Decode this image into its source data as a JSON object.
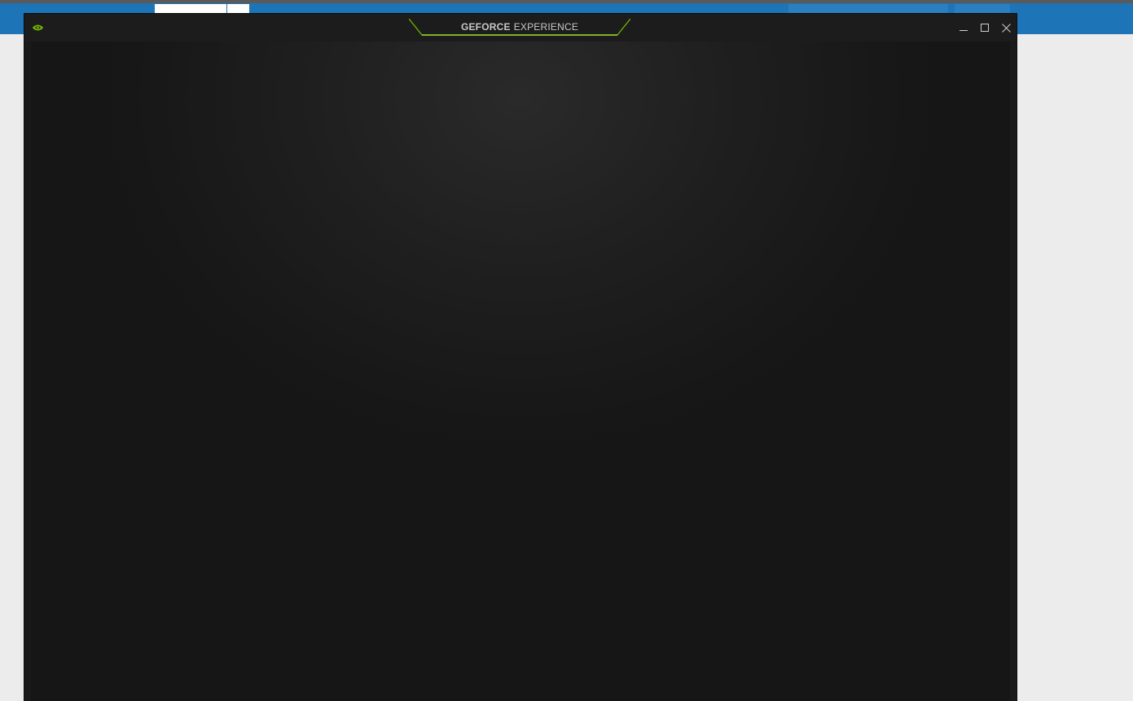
{
  "background_app": {
    "bar_color": "#1d74b7"
  },
  "window": {
    "brand": {
      "bold": "GEFORCE",
      "light": "EXPERIENCE",
      "accent_color": "#76b900"
    },
    "controls": {
      "minimize": "minimize-icon",
      "maximize": "maximize-icon",
      "close": "close-icon"
    },
    "logo": "nvidia-eye-icon"
  }
}
